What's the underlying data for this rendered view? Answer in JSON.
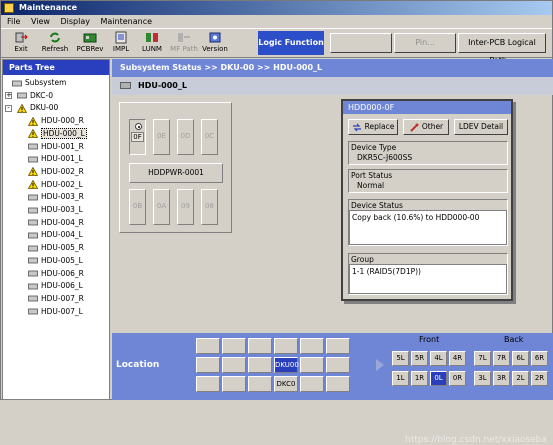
{
  "window": {
    "title": "Maintenance"
  },
  "menu": [
    {
      "label": "File"
    },
    {
      "label": "View"
    },
    {
      "label": "Display"
    },
    {
      "label": "Maintenance"
    }
  ],
  "toolbar": {
    "buttons": [
      {
        "label": "Exit",
        "icon": "exit-icon",
        "enabled": true
      },
      {
        "label": "Refresh",
        "icon": "refresh-icon",
        "enabled": true
      },
      {
        "label": "PCBRev",
        "icon": "pcb-icon",
        "enabled": true
      },
      {
        "label": "IMPL",
        "icon": "impl-icon",
        "enabled": true
      },
      {
        "label": "LUNM",
        "icon": "lunm-icon",
        "enabled": true
      },
      {
        "label": "MF Path",
        "icon": "mfpath-icon",
        "enabled": false
      },
      {
        "label": "Version",
        "icon": "version-icon",
        "enabled": true
      }
    ],
    "logic_function": "Logic Function",
    "group_buttons": [
      {
        "label": "",
        "enabled": false
      },
      {
        "label": "",
        "enabled": false
      },
      {
        "label": "Pin...",
        "enabled": false
      },
      {
        "label": "Inter-PCB Logical Path...",
        "enabled": true
      }
    ]
  },
  "parts_tree": {
    "header": "Parts Tree",
    "nodes": [
      {
        "label": "Subsystem",
        "level": 0,
        "warn": false
      },
      {
        "label": "DKC-0",
        "level": 1,
        "warn": false,
        "expander": "+"
      },
      {
        "label": "DKU-00",
        "level": 1,
        "warn": true,
        "expander": "-"
      },
      {
        "label": "HDU-000_R",
        "level": 2,
        "warn": true
      },
      {
        "label": "HDU-000_L",
        "level": 2,
        "warn": true,
        "selected": true
      },
      {
        "label": "HDU-001_R",
        "level": 2,
        "warn": false
      },
      {
        "label": "HDU-001_L",
        "level": 2,
        "warn": false
      },
      {
        "label": "HDU-002_R",
        "level": 2,
        "warn": true
      },
      {
        "label": "HDU-002_L",
        "level": 2,
        "warn": true
      },
      {
        "label": "HDU-003_R",
        "level": 2,
        "warn": false
      },
      {
        "label": "HDU-003_L",
        "level": 2,
        "warn": false
      },
      {
        "label": "HDU-004_R",
        "level": 2,
        "warn": false
      },
      {
        "label": "HDU-004_L",
        "level": 2,
        "warn": false
      },
      {
        "label": "HDU-005_R",
        "level": 2,
        "warn": false
      },
      {
        "label": "HDU-005_L",
        "level": 2,
        "warn": false
      },
      {
        "label": "HDU-006_R",
        "level": 2,
        "warn": false
      },
      {
        "label": "HDU-006_L",
        "level": 2,
        "warn": false
      },
      {
        "label": "HDU-007_R",
        "level": 2,
        "warn": false
      },
      {
        "label": "HDU-007_L",
        "level": 2,
        "warn": false
      }
    ]
  },
  "main": {
    "breadcrumb": "Subsystem Status >> DKU-00 >> HDU-000_L",
    "hdu_title": "HDU-000_L",
    "slots_top": [
      "0F",
      "0E",
      "0D",
      "0C"
    ],
    "power_label": "HDDPWR-0001",
    "slots_bottom": [
      "0B",
      "0A",
      "09",
      "08"
    ]
  },
  "detail": {
    "title": "HDD000-0F",
    "buttons": {
      "replace": "Replace",
      "other": "Other",
      "ldev": "LDEV Detail"
    },
    "device_type_label": "Device Type",
    "device_type": "DKR5C-J600SS",
    "port_status_label": "Port Status",
    "port_status": "Normal",
    "device_status_label": "Device Status",
    "device_status": "Copy back (10.6%) to HDD000-00",
    "group_label": "Group",
    "group": "1-1 (RAID5(7D1P))"
  },
  "location": {
    "label": "Location",
    "dku_label": "DKU00",
    "dkc_label": "DKC0",
    "front_label": "Front",
    "back_label": "Back",
    "front_row1": [
      "5L",
      "5R",
      "4L",
      "4R"
    ],
    "front_row2": [
      "1L",
      "1R",
      "0L",
      "0R"
    ],
    "back_row1": [
      "7L",
      "7R",
      "6L",
      "6R"
    ],
    "back_row2": [
      "3L",
      "3R",
      "2L",
      "2R"
    ]
  },
  "watermark": "https://blog.csdn.net/xxiaoseba",
  "colors": {
    "accent_blue": "#2a3fbe",
    "header_blue": "#6f86d6",
    "warn_yellow": "#ffd800"
  }
}
